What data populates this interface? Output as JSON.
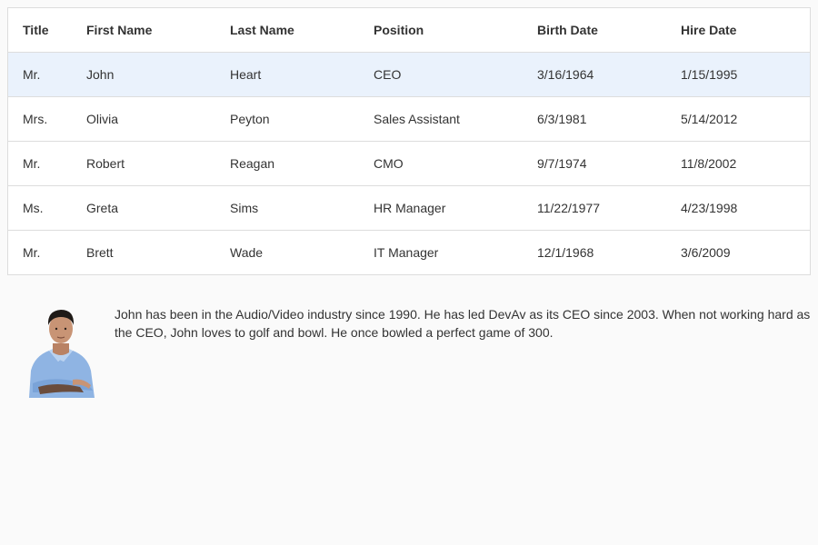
{
  "grid": {
    "columns": [
      "Title",
      "First Name",
      "Last Name",
      "Position",
      "Birth Date",
      "Hire Date"
    ],
    "rows": [
      {
        "title": "Mr.",
        "first": "John",
        "last": "Heart",
        "position": "CEO",
        "birth": "3/16/1964",
        "hire": "1/15/1995"
      },
      {
        "title": "Mrs.",
        "first": "Olivia",
        "last": "Peyton",
        "position": "Sales Assistant",
        "birth": "6/3/1981",
        "hire": "5/14/2012"
      },
      {
        "title": "Mr.",
        "first": "Robert",
        "last": "Reagan",
        "position": "CMO",
        "birth": "9/7/1974",
        "hire": "11/8/2002"
      },
      {
        "title": "Ms.",
        "first": "Greta",
        "last": "Sims",
        "position": "HR Manager",
        "birth": "11/22/1977",
        "hire": "4/23/1998"
      },
      {
        "title": "Mr.",
        "first": "Brett",
        "last": "Wade",
        "position": "IT Manager",
        "birth": "12/1/1968",
        "hire": "3/6/2009"
      }
    ],
    "selected_row": 0
  },
  "detail": {
    "photo_icon": "employee-photo",
    "text": "John has been in the Audio/Video industry since 1990. He has led DevAv as its CEO since 2003. When not working hard as the CEO, John loves to golf and bowl. He once bowled a perfect game of 300."
  },
  "colors": {
    "selected_row_bg": "#eaf2fc",
    "border": "#dddddd",
    "background": "#fafafa"
  }
}
